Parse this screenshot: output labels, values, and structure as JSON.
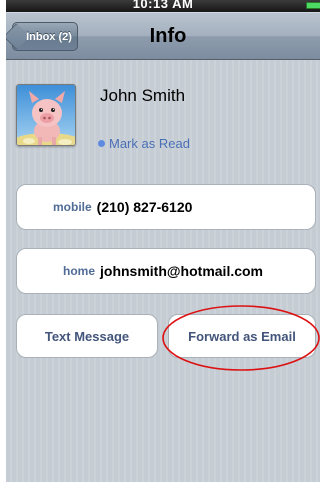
{
  "status_bar": {
    "time": "10:13 AM"
  },
  "nav": {
    "back_label": "Inbox (2)",
    "title": "Info"
  },
  "contact": {
    "name": "John Smith",
    "mark_as_read": "Mark as Read"
  },
  "fields": [
    {
      "label": "mobile",
      "value": "(210) 827-6120"
    },
    {
      "label": "home",
      "value": "johnsmith@hotmail.com"
    }
  ],
  "actions": {
    "text_message": "Text Message",
    "forward_email": "Forward as Email"
  },
  "colors": {
    "accent_link": "#4a6fb5",
    "annotation_circle": "#dd1111"
  }
}
